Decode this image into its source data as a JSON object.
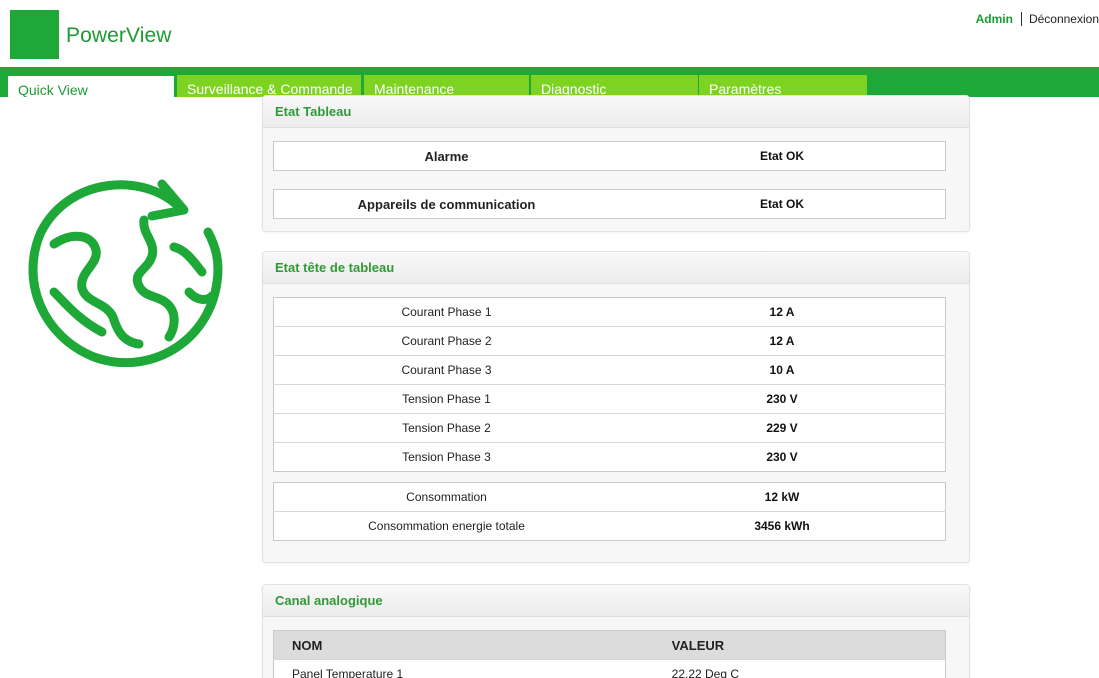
{
  "header": {
    "app_title": "PowerView",
    "user": "Admin",
    "logout": "Déconnexion"
  },
  "nav": {
    "tabs": [
      {
        "label": "Quick View",
        "active": true
      },
      {
        "label": "Surveillance & Commande",
        "active": false
      },
      {
        "label": "Maintenance",
        "active": false
      },
      {
        "label": "Diagnostic",
        "active": false
      },
      {
        "label": "Paramètres",
        "active": false
      }
    ]
  },
  "sidebar": {
    "icon": "globe-arrow-icon"
  },
  "etat_tableau": {
    "title": "Etat Tableau",
    "rows": [
      {
        "label": "Alarme",
        "value": "Etat OK"
      },
      {
        "label": "Appareils de communication",
        "value": "Etat OK"
      }
    ]
  },
  "etat_tete": {
    "title": "Etat tête de tableau",
    "phases": [
      {
        "label": "Courant Phase 1",
        "value": "12 A"
      },
      {
        "label": "Courant Phase 2",
        "value": "12 A"
      },
      {
        "label": "Courant Phase 3",
        "value": "10 A"
      },
      {
        "label": "Tension Phase 1",
        "value": "230 V"
      },
      {
        "label": "Tension Phase 2",
        "value": "229 V"
      },
      {
        "label": "Tension Phase 3",
        "value": "230 V"
      }
    ],
    "consumption": [
      {
        "label": "Consommation",
        "value": "12 kW"
      },
      {
        "label": "Consommation energie totale",
        "value": "3456 kWh"
      }
    ]
  },
  "canal": {
    "title": "Canal analogique",
    "col_name": "NOM",
    "col_value": "VALEUR",
    "rows": [
      {
        "name": "Panel Temperature 1",
        "value": "22.22 Deg C"
      }
    ]
  },
  "colors": {
    "brand_green": "#1ea838",
    "tab_light_green": "#7ed321",
    "header_text_green": "#2f9a35"
  }
}
